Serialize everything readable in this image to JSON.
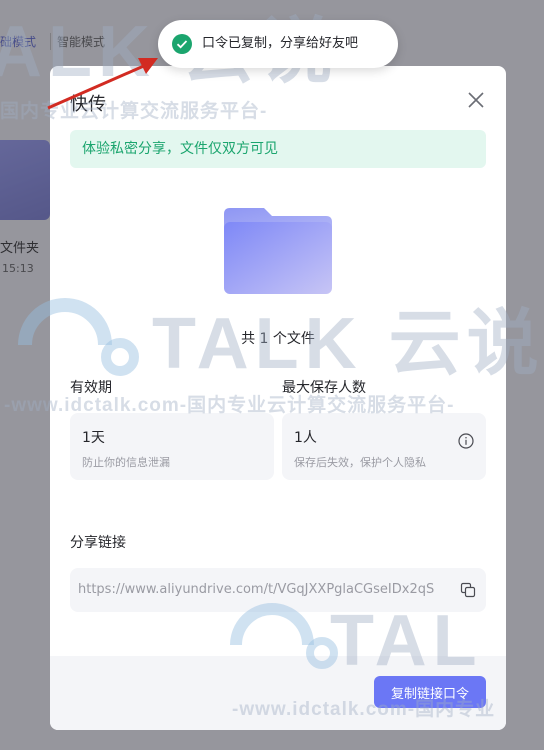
{
  "background_app": {
    "tabs": [
      "础模式",
      "智能模式"
    ],
    "file_name": "文件夹",
    "file_time": "15:13"
  },
  "watermark": {
    "brand": "TALK 云说",
    "tagline": "-www.idctalk.com-国内专业云计算交流服务平台-",
    "tagline_top": "国内专业云计算交流服务平台-",
    "partial_top": "ALK 云说",
    "partial_bottom": "-www.idctalk.com-国内专业",
    "partial_talk": "TAL"
  },
  "toast": {
    "icon": "check-circle-icon",
    "text": "口令已复制，分享给好友吧",
    "color": "#1ba56e"
  },
  "dialog": {
    "title": "快传",
    "close_icon": "close-icon",
    "tip": "体验私密分享，文件仅双方可见",
    "folder_icon": "folder-icon",
    "file_count": "共 1 个文件",
    "validity": {
      "label": "有效期",
      "value": "1天",
      "hint": "防止你的信息泄漏"
    },
    "max_saves": {
      "label": "最大保存人数",
      "value": "1人",
      "hint": "保存后失效，保护个人隐私",
      "icon": "info-icon"
    },
    "share_link": {
      "label": "分享链接",
      "url": "https://www.aliyundrive.com/t/VGqJXXPglaCGseIDx2qS",
      "icon": "copy-icon"
    },
    "copy_button": "复制链接口令"
  },
  "colors": {
    "accent": "#6b77f5",
    "success": "#1ba56e",
    "arrow": "#d22b22"
  }
}
